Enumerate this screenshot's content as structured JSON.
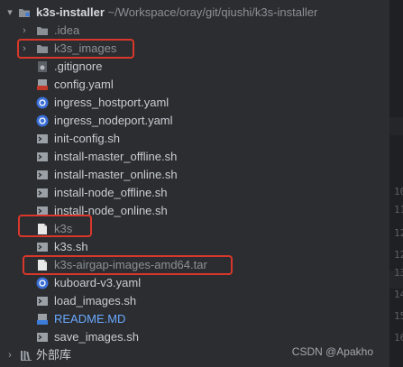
{
  "project": {
    "name": "k3s-installer",
    "path": "~/Workspace/oray/git/qiushi/k3s-installer"
  },
  "tree": [
    {
      "label": ".idea",
      "kind": "folder",
      "expanded": false,
      "style": "dim"
    },
    {
      "label": "k3s_images",
      "kind": "folder",
      "expanded": false,
      "style": "dim"
    },
    {
      "label": ".gitignore",
      "kind": "gitignore",
      "style": "normal"
    },
    {
      "label": "config.yaml",
      "kind": "yaml",
      "style": "normal"
    },
    {
      "label": "ingress_hostport.yaml",
      "kind": "k8s",
      "style": "normal"
    },
    {
      "label": "ingress_nodeport.yaml",
      "kind": "k8s",
      "style": "normal"
    },
    {
      "label": "init-config.sh",
      "kind": "shell",
      "style": "normal"
    },
    {
      "label": "install-master_offline.sh",
      "kind": "shell",
      "style": "normal"
    },
    {
      "label": "install-master_online.sh",
      "kind": "shell",
      "style": "normal"
    },
    {
      "label": "install-node_offline.sh",
      "kind": "shell",
      "style": "normal"
    },
    {
      "label": "install-node_online.sh",
      "kind": "shell",
      "style": "normal"
    },
    {
      "label": "k3s",
      "kind": "file",
      "style": "dim"
    },
    {
      "label": "k3s.sh",
      "kind": "shell",
      "style": "normal"
    },
    {
      "label": "k3s-airgap-images-amd64.tar",
      "kind": "file",
      "style": "dim"
    },
    {
      "label": "kuboard-v3.yaml",
      "kind": "k8s",
      "style": "normal"
    },
    {
      "label": "load_images.sh",
      "kind": "shell",
      "style": "normal"
    },
    {
      "label": "README.MD",
      "kind": "markdown",
      "style": "blue"
    },
    {
      "label": "save_images.sh",
      "kind": "shell",
      "style": "normal"
    }
  ],
  "external_libraries": "外部库",
  "gutter_numbers": [
    "10",
    "11",
    "12",
    "12",
    "13",
    "14",
    "15",
    "16"
  ],
  "watermark": "CSDN @Apakho",
  "colors": {
    "background": "#2b2d30",
    "highlight": "#d9372b",
    "k8s_icon": "#3b6fd8",
    "yaml_icon": "#c0392b",
    "folder_icon": "#8a8f96"
  }
}
